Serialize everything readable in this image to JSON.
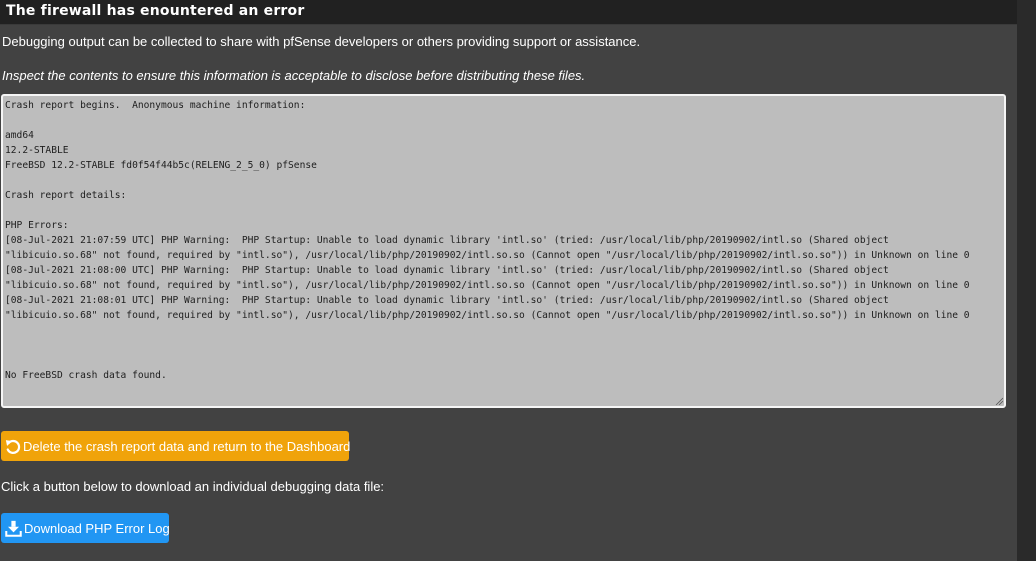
{
  "panel": {
    "title": "The firewall has enountered an error",
    "intro": "Debugging output can be collected to share with pfSense developers or others providing support or assistance.",
    "notice": "Inspect the contents to ensure this information is acceptable to disclose before distributing these files."
  },
  "crash_report": {
    "lines": [
      "Crash report begins.  Anonymous machine information:",
      "",
      "amd64",
      "12.2-STABLE",
      "FreeBSD 12.2-STABLE fd0f54f44b5c(RELENG_2_5_0) pfSense",
      "",
      "Crash report details:",
      "",
      "PHP Errors:",
      "[08-Jul-2021 21:07:59 UTC] PHP Warning:  PHP Startup: Unable to load dynamic library 'intl.so' (tried: /usr/local/lib/php/20190902/intl.so (Shared object",
      "\"libicuio.so.68\" not found, required by \"intl.so\"), /usr/local/lib/php/20190902/intl.so.so (Cannot open \"/usr/local/lib/php/20190902/intl.so.so\")) in Unknown on line 0",
      "[08-Jul-2021 21:08:00 UTC] PHP Warning:  PHP Startup: Unable to load dynamic library 'intl.so' (tried: /usr/local/lib/php/20190902/intl.so (Shared object",
      "\"libicuio.so.68\" not found, required by \"intl.so\"), /usr/local/lib/php/20190902/intl.so.so (Cannot open \"/usr/local/lib/php/20190902/intl.so.so\")) in Unknown on line 0",
      "[08-Jul-2021 21:08:01 UTC] PHP Warning:  PHP Startup: Unable to load dynamic library 'intl.so' (tried: /usr/local/lib/php/20190902/intl.so (Shared object",
      "\"libicuio.so.68\" not found, required by \"intl.so\"), /usr/local/lib/php/20190902/intl.so.so (Cannot open \"/usr/local/lib/php/20190902/intl.so.so\")) in Unknown on line 0",
      "",
      "",
      "",
      "No FreeBSD crash data found."
    ]
  },
  "actions": {
    "delete_label": "Delete the crash report data and return to the Dashboard",
    "delete_icon": "undo-icon",
    "download_hint": "Click a button below to download an individual debugging data file:",
    "download_label": "Download PHP Error Log",
    "download_icon": "download-icon"
  },
  "colors": {
    "page_bg": "#424242",
    "heading_bg": "#212121",
    "textarea_bg": "#bdbdbd",
    "warning_button": "#f0a30a",
    "primary_button": "#2196f3"
  }
}
